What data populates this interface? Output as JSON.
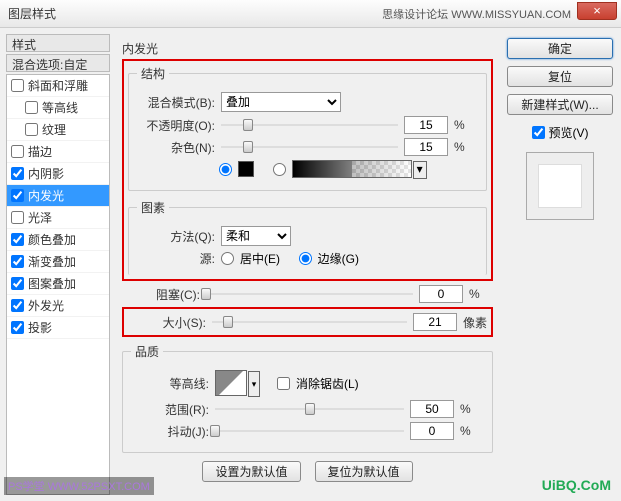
{
  "window": {
    "title": "图层样式",
    "watermark_tr": "思缘设计论坛  WWW.MISSYUAN.COM",
    "close": "×"
  },
  "sidebar": {
    "header": "样式",
    "subheader": "混合选项:自定",
    "items": [
      {
        "label": "斜面和浮雕",
        "checked": false,
        "indent": false
      },
      {
        "label": "等高线",
        "checked": false,
        "indent": true
      },
      {
        "label": "纹理",
        "checked": false,
        "indent": true
      },
      {
        "label": "描边",
        "checked": false,
        "indent": false
      },
      {
        "label": "内阴影",
        "checked": true,
        "indent": false
      },
      {
        "label": "内发光",
        "checked": true,
        "indent": false,
        "selected": true
      },
      {
        "label": "光泽",
        "checked": false,
        "indent": false
      },
      {
        "label": "颜色叠加",
        "checked": true,
        "indent": false
      },
      {
        "label": "渐变叠加",
        "checked": true,
        "indent": false
      },
      {
        "label": "图案叠加",
        "checked": true,
        "indent": false
      },
      {
        "label": "外发光",
        "checked": true,
        "indent": false
      },
      {
        "label": "投影",
        "checked": true,
        "indent": false
      }
    ]
  },
  "panel": {
    "title": "内发光",
    "structure": {
      "legend": "结构",
      "blend_label": "混合模式(B):",
      "blend_value": "叠加",
      "opacity_label": "不透明度(O):",
      "opacity_value": "15",
      "opacity_unit": "%",
      "noise_label": "杂色(N):",
      "noise_value": "15",
      "noise_unit": "%",
      "color_swatch": "#000000"
    },
    "elements": {
      "legend": "图素",
      "technique_label": "方法(Q):",
      "technique_value": "柔和",
      "source_label": "源:",
      "source_center": "居中(E)",
      "source_edge": "边缘(G)",
      "source_selected": "edge",
      "choke_label": "阻塞(C):",
      "choke_value": "0",
      "choke_unit": "%",
      "size_label": "大小(S):",
      "size_value": "21",
      "size_unit": "像素"
    },
    "quality": {
      "legend": "品质",
      "contour_label": "等高线:",
      "antialias_label": "消除锯齿(L)",
      "range_label": "范围(R):",
      "range_value": "50",
      "range_unit": "%",
      "jitter_label": "抖动(J):",
      "jitter_value": "0",
      "jitter_unit": "%"
    },
    "buttons": {
      "set_default": "设置为默认值",
      "reset_default": "复位为默认值"
    }
  },
  "right": {
    "ok": "确定",
    "cancel": "复位",
    "new_style": "新建样式(W)...",
    "preview": "预览(V)"
  },
  "footer": {
    "wm_right": "UiBQ.CoM",
    "wm_left": "PS学堂  WWW.52PSXT.COM"
  }
}
